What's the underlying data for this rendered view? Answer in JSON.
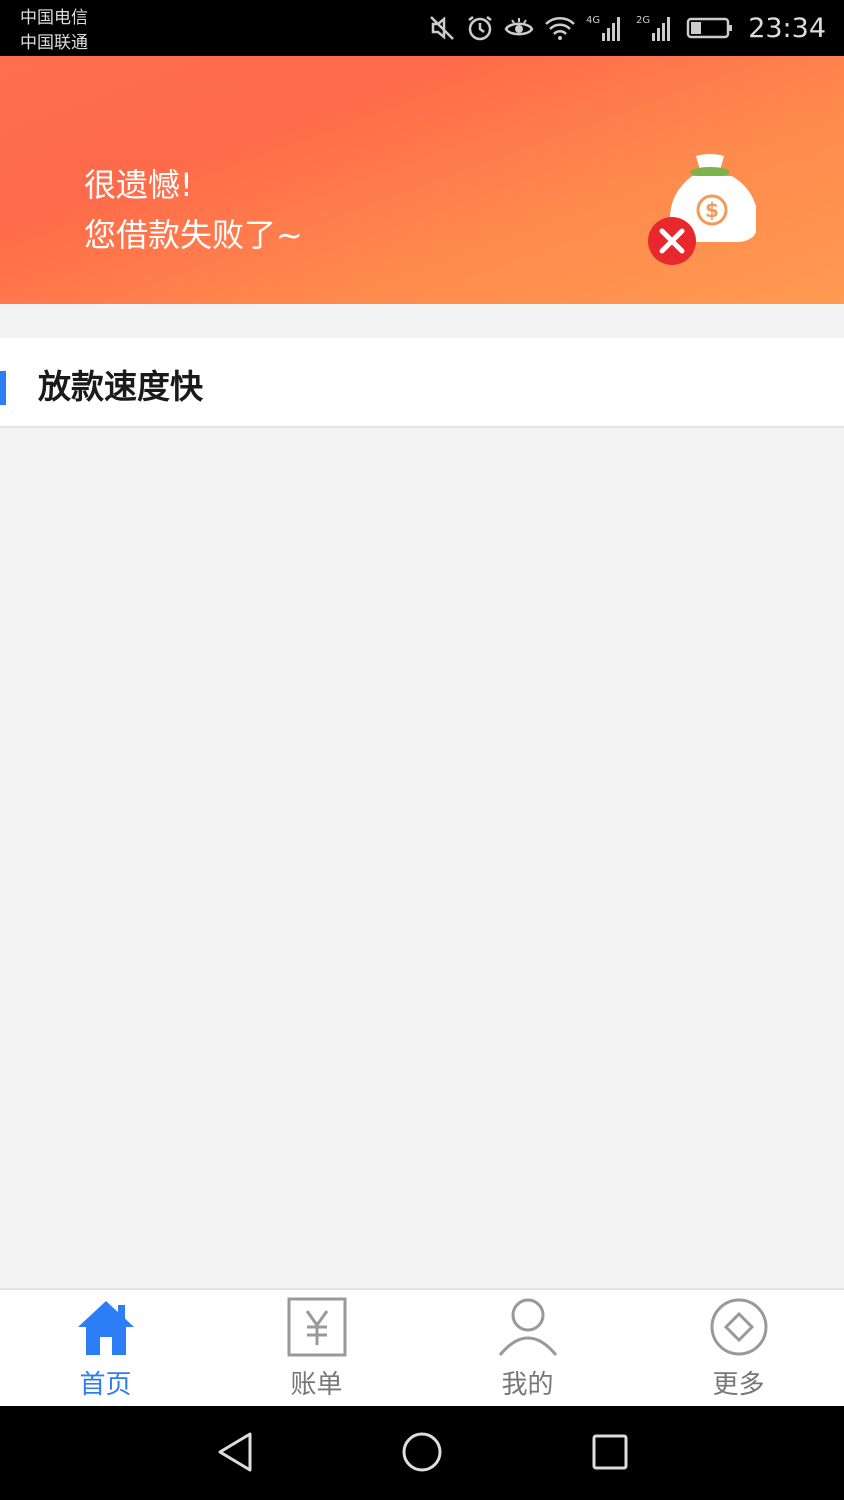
{
  "status_bar": {
    "carrier1": "中国电信",
    "carrier2": "中国联通",
    "net1": "4G",
    "net2": "2G",
    "time": "23:34",
    "battery_level": 0.3,
    "icons": [
      "mute-icon",
      "alarm-icon",
      "eye-icon",
      "wifi-icon",
      "signal-4g-icon",
      "signal-2g-icon",
      "battery-icon"
    ]
  },
  "banner": {
    "line1": "很遗憾!",
    "line2": "您借款失败了~",
    "image": "money-bag-failed-icon",
    "colors": {
      "start": "#ff6a4a",
      "end": "#ff9a50"
    }
  },
  "section": {
    "title": "放款速度快",
    "accent": "#2d7df6"
  },
  "tabs": [
    {
      "label": "首页",
      "icon": "home-icon",
      "active": true
    },
    {
      "label": "账单",
      "icon": "bill-icon",
      "active": false
    },
    {
      "label": "我的",
      "icon": "user-icon",
      "active": false
    },
    {
      "label": "更多",
      "icon": "more-icon",
      "active": false
    }
  ],
  "nav": {
    "buttons": [
      "back-icon",
      "home-circle-icon",
      "recents-icon"
    ]
  }
}
